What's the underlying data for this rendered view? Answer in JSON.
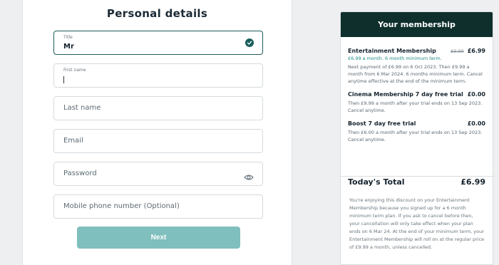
{
  "form": {
    "title": "Personal details",
    "title_field": {
      "label": "Title",
      "value": "Mr"
    },
    "first_name": {
      "label": "First name"
    },
    "last_name": {
      "placeholder": "Last name"
    },
    "email": {
      "placeholder": "Email"
    },
    "password": {
      "placeholder": "Password"
    },
    "mobile": {
      "placeholder": "Mobile phone number (Optional)"
    },
    "next_label": "Next"
  },
  "membership": {
    "heading": "Your membership",
    "items": [
      {
        "title": "Entertainment Membership",
        "old_price": "£9.99",
        "price": "£6.99",
        "subtitle": "£6.99 a month. 6 month minimum term.",
        "description": "Next payment of £6.99 on 6 Oct 2023. Then £9.99 a month from 6 Mar 2024. 6 months minimum term. Cancel anytime effective at the end of the minimum term."
      },
      {
        "title": "Cinema Membership 7 day free trial",
        "price": "£0.00",
        "description": "Then £9.99 a month after your trial ends on 13 Sep 2023. Cancel anytime."
      },
      {
        "title": "Boost 7 day free trial",
        "price": "£0.00",
        "description": "Then £6.00 a month after your trial ends on 13 Sep 2023. Cancel anytime."
      }
    ],
    "total_label": "Today's Total",
    "total_price": "£6.99",
    "total_note": "You're enjoying this discount on your Entertainment Membership because you signed up for a 6 month minimum term plan. If you ask to cancel before then, your cancellation will only take effect when your plan ends on 6 Mar 24. At the end of your minimum term, your Entertainment Membership will roll on at the regular price of £9.99 a month, unless cancelled."
  },
  "colors": {
    "accent": "#0e2f2c",
    "button": "#7fbfbd",
    "check": "#1a5f5c",
    "link_text": "#1c8a84"
  }
}
